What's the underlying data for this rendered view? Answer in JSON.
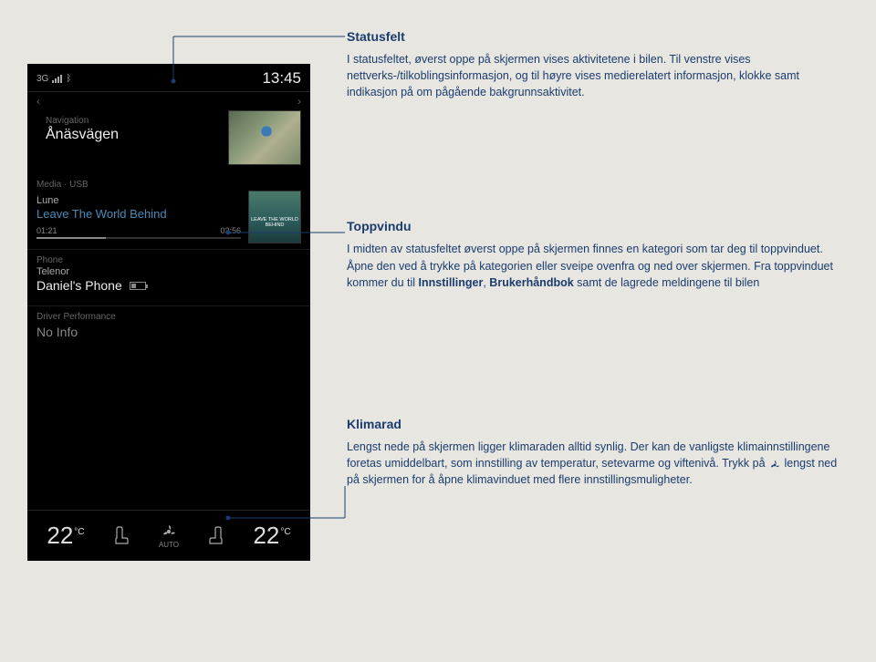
{
  "screen": {
    "status": {
      "network": "3G",
      "bluetooth_icon": "bluetooth",
      "clock": "13:45"
    },
    "nav": {
      "section": "Navigation",
      "destination": "Ånäsvägen"
    },
    "media": {
      "section": "Media · USB",
      "artist": "Lune",
      "track": "Leave The World Behind",
      "elapsed": "01:21",
      "total": "03:56",
      "album_text": "LEAVE THE WORLD BEHIND"
    },
    "phone": {
      "section": "Phone",
      "carrier": "Telenor",
      "device": "Daniel's Phone"
    },
    "perf": {
      "section": "Driver Performance",
      "value": "No Info"
    },
    "climate": {
      "left_temp": "22",
      "left_unit": "°C",
      "auto": "AUTO",
      "right_temp": "22",
      "right_unit": "°C"
    }
  },
  "text": {
    "status": {
      "heading": "Statusfelt",
      "body": "I statusfeltet, øverst oppe på skjermen vises aktivitetene i bilen. Til venstre vises nettverks-/tilkoblingsinformasjon, og til høyre vises medierelatert informasjon, klokke samt indikasjon på om pågående bakgrunnsaktivitet."
    },
    "top": {
      "heading": "Toppvindu",
      "body_pre": "I midten av statusfeltet øverst oppe på skjermen finnes en kategori som tar deg til toppvinduet. Åpne den ved å trykke på kategorien eller sveipe ovenfra og ned over skjermen. Fra toppvinduet kommer du til ",
      "bold1": "Innstillinger",
      "body_mid": ", ",
      "bold2": "Brukerhåndbok",
      "body_post": " samt de lagrede meldingene til bilen"
    },
    "climate": {
      "heading": "Klimarad",
      "body_pre": "Lengst nede på skjermen ligger klimaraden alltid synlig. Der kan de vanligste klimainnstillingene foretas umiddelbart, som innstilling av temperatur, setevarme og viftenivå. Trykk på ",
      "body_post": " lengst ned på skjermen for å åpne klimavinduet med flere innstillingsmuligheter."
    }
  }
}
